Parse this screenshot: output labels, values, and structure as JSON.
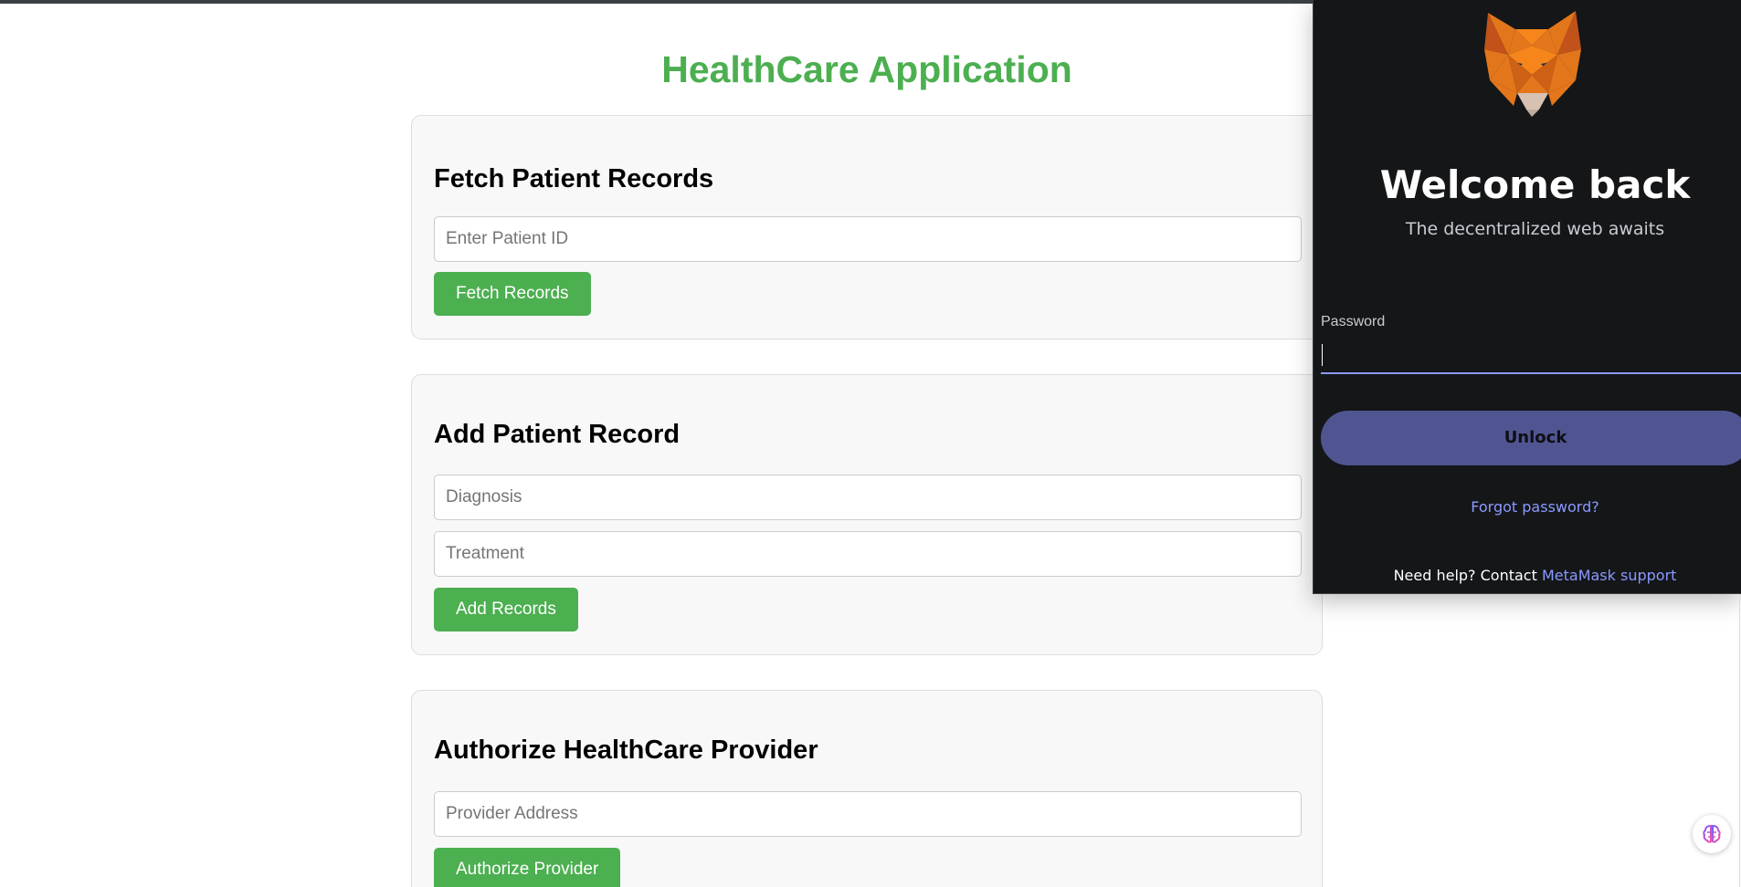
{
  "app": {
    "title": "HealthCare Application",
    "accent_color": "#4caf50"
  },
  "fetch_section": {
    "heading": "Fetch Patient Records",
    "patient_id_placeholder": "Enter Patient ID",
    "patient_id_value": "",
    "button_label": "Fetch Records"
  },
  "add_section": {
    "heading": "Add Patient Record",
    "diagnosis_placeholder": "Diagnosis",
    "treatment_placeholder": "Treatment",
    "button_label": "Add Records"
  },
  "authorize_section": {
    "heading": "Authorize HealthCare Provider",
    "provider_placeholder": "Provider Address",
    "button_label": "Authorize Provider"
  },
  "metamask": {
    "logo_icon": "metamask-fox-icon",
    "title": "Welcome back",
    "subtitle": "The decentralized web awaits",
    "password_label": "Password",
    "password_value": "",
    "unlock_label": "Unlock",
    "forgot_label": "Forgot password?",
    "help_prefix": "Need help? Contact ",
    "help_link": "MetaMask support",
    "link_color": "#8b99ff",
    "button_color": "#505592"
  },
  "floating_button": {
    "icon": "brain-icon"
  }
}
